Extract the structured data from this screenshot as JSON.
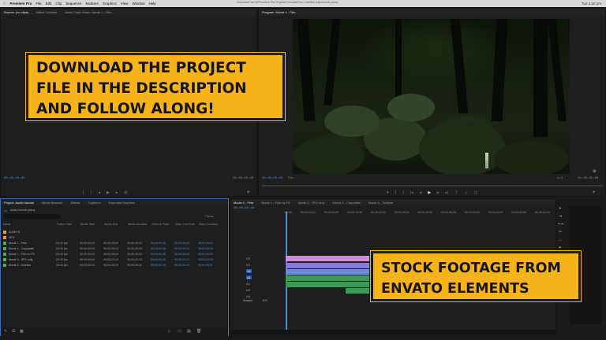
{
  "menubar": {
    "app": "Premiere Pro",
    "items": [
      "File",
      "Edit",
      "Clip",
      "Sequence",
      "Markers",
      "Graphics",
      "View",
      "Window",
      "Help"
    ],
    "clock": "Tue 2:18 pm",
    "path": "/Volumes/Pub-02/Premiere Pro Projects/Tutorials/Film Look/film-look-tutorial.prproj"
  },
  "source_panel": {
    "tabs": [
      "Source: (no clips)",
      "Effect Controls",
      "Audio Track Mixer: Movie 1 - Film"
    ],
    "timecode_left": "00;00;00;00",
    "timecode_right": "00;00;00;00"
  },
  "program_panel": {
    "tab": "Program: Movie 1 - Film",
    "timecode_left": "00;00;00;00",
    "fit": "Fit",
    "quality": "1/4",
    "timecode_right": "00;00;35;00"
  },
  "project_panel": {
    "tabs": [
      "Project: Audio tutorial",
      "Media Browser",
      "Effects",
      "Captions",
      "Essential Graphics"
    ],
    "path": "Audio tutorial.prproj",
    "item_count": "7 Items",
    "columns": [
      "Name",
      "Frame Rate",
      "Media Start",
      "Media End",
      "Media Duration",
      "Video In Point",
      "Video Out Point",
      "Video Duration"
    ],
    "rows": [
      {
        "name": "ASSETS",
        "color": "#e59b2e",
        "cells": [
          "",
          "",
          "",
          "",
          "",
          "",
          ""
        ]
      },
      {
        "name": "SFX",
        "color": "#e59b2e",
        "cells": [
          "",
          "",
          "",
          "",
          "",
          "",
          ""
        ]
      },
      {
        "name": "Movie 1 - Film",
        "color": "#4caf50",
        "cells": [
          "25.00 fps",
          "00;00;00;00",
          "00;00;35;00",
          "00;00;35;01",
          "00;00;00;00",
          "00;00;35;00",
          "00;00;35;01"
        ]
      },
      {
        "name": "Movie 2 - Corporate",
        "color": "#4caf50",
        "cells": [
          "25.00 fps",
          "00;00;00;00",
          "00;00;25;14",
          "00;00;25;15",
          "00;00;00;00",
          "00;00;25;14",
          "00;00;25;15"
        ]
      },
      {
        "name": "Movie 1 - Film vs FX",
        "color": "#4caf50",
        "cells": [
          "25.00 fps",
          "00;00;00;00",
          "00;00;35;00",
          "00;00;35;01",
          "00;00;00;00",
          "00;00;35;00",
          "00;00;35;01"
        ]
      },
      {
        "name": "Movie 3 - SFX only",
        "color": "#4caf50",
        "cells": [
          "25.00 fps",
          "00;00;00;00",
          "00;00;22;12",
          "00;00;22;13",
          "00;00;00;00",
          "00;00;22;12",
          "00;00;22;13"
        ]
      },
      {
        "name": "Movie 4 - Tourism",
        "color": "#4caf50",
        "cells": [
          "25.00 fps",
          "00;00;00;00",
          "00;00;30;10",
          "00;00;30;11",
          "00;00;00;00",
          "00;00;30;10",
          "00;00;30;11"
        ]
      }
    ]
  },
  "timeline": {
    "tabs": [
      "Movie 1 - Film",
      "Movie 1 - Film vs FX",
      "Movie 2 - SFX only",
      "Movie 3 - Corporate",
      "Movie 4 - Tourism"
    ],
    "timecode": "00;00;00;00",
    "ruler": [
      "00;00",
      "00;00;05;00",
      "00;00;10;00",
      "00;00;15;00",
      "00;00;20;00",
      "00;00;25;00",
      "00;00;30;00",
      "00;00;35;00",
      "00;00;40;00",
      "00;00;45;00",
      "00;00;50;00",
      "00;00;55;00"
    ],
    "video_tracks": [
      "V3",
      "V2",
      "V1"
    ],
    "audio_tracks": [
      "A1",
      "A2",
      "A3",
      "A4"
    ],
    "master": "Master",
    "master_value": "0.0",
    "clip_label": "Adjustment Layer"
  },
  "callouts": {
    "top": "Download the project file in the description and follow along!",
    "bottom": "Stock footage from Envato Elements"
  },
  "colors": {
    "accent_yellow": "#f6b31a",
    "timecode_blue": "#4a90d9",
    "clip_pink": "#d58ad6",
    "clip_green": "#3c9a55"
  }
}
